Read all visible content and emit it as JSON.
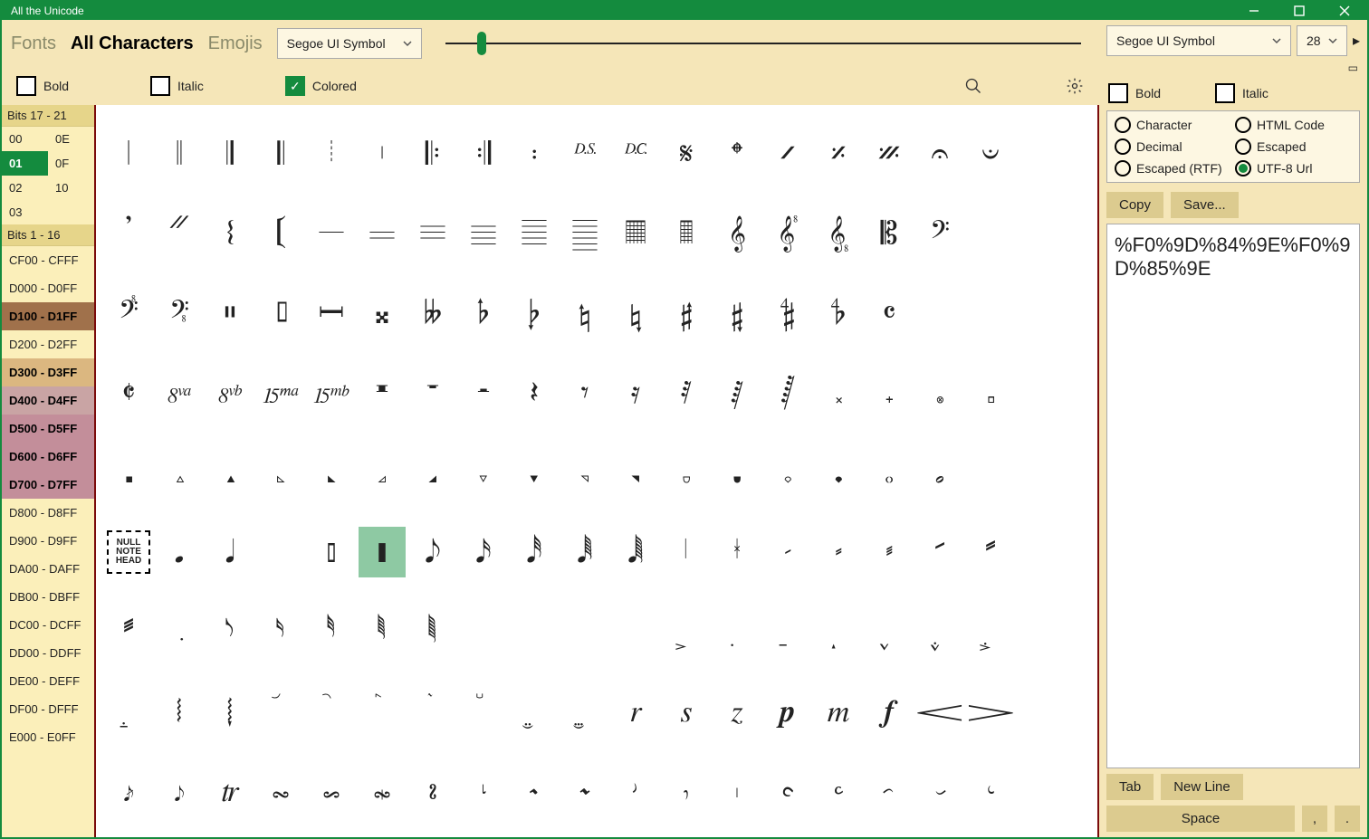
{
  "app_title": "All the Unicode",
  "tabs": {
    "fonts": "Fonts",
    "all": "All Characters",
    "emojis": "Emojis"
  },
  "font_select": "Segoe UI Symbol",
  "checks": {
    "bold": "Bold",
    "italic": "Italic",
    "colored": "Colored"
  },
  "sidebar": {
    "hdr_bits_hi": "Bits 17 - 21",
    "bits_hi": [
      [
        "00",
        "0E"
      ],
      [
        "01",
        "0F"
      ],
      [
        "02",
        "10"
      ],
      [
        "03",
        ""
      ]
    ],
    "hdr_bits_lo": "Bits 1 - 16",
    "ranges": [
      {
        "label": "CF00 - CFFF",
        "cls": "a"
      },
      {
        "label": "D000 - D0FF",
        "cls": "a"
      },
      {
        "label": "D100 - D1FF",
        "cls": "b"
      },
      {
        "label": "D200 - D2FF",
        "cls": "a"
      },
      {
        "label": "D300 - D3FF",
        "cls": "c"
      },
      {
        "label": "D400 - D4FF",
        "cls": "d"
      },
      {
        "label": "D500 - D5FF",
        "cls": "e"
      },
      {
        "label": "D600 - D6FF",
        "cls": "e"
      },
      {
        "label": "D700 - D7FF",
        "cls": "e"
      },
      {
        "label": "D800 - D8FF",
        "cls": "a"
      },
      {
        "label": "D900 - D9FF",
        "cls": "a"
      },
      {
        "label": "DA00 - DAFF",
        "cls": "a"
      },
      {
        "label": "DB00 - DBFF",
        "cls": "a"
      },
      {
        "label": "DC00 - DCFF",
        "cls": "a"
      },
      {
        "label": "DD00 - DDFF",
        "cls": "a"
      },
      {
        "label": "DE00 - DEFF",
        "cls": "a"
      },
      {
        "label": "DF00 - DFFF",
        "cls": "a"
      },
      {
        "label": "E000 - E0FF",
        "cls": "a"
      }
    ]
  },
  "right": {
    "font": "Segoe UI Symbol",
    "size": "28",
    "bold": "Bold",
    "italic": "Italic",
    "radios": {
      "char": "Character",
      "html": "HTML Code",
      "dec": "Decimal",
      "esc": "Escaped",
      "escrtf": "Escaped (RTF)",
      "utf8": "UTF-8 Url"
    },
    "copy": "Copy",
    "save": "Save...",
    "output": "%F0%9D%84%9E%F0%9D%85%9E",
    "tab": "Tab",
    "newline": "New Line",
    "space": "Space",
    "comma": ",",
    "dot": "."
  },
  "selected_index": 95,
  "chars": [
    "𝄀",
    "𝄁",
    "𝄂",
    "𝄃",
    "𝄄",
    "𝄅",
    "𝄆",
    "𝄇",
    "𝄈",
    "𝄉",
    "𝄊",
    "𝄋",
    "𝄌",
    "𝄍",
    "𝄎",
    "𝄏",
    "𝄐",
    "𝄑",
    "𝄒",
    "𝄓",
    "𝄔",
    "𝄕",
    "𝄖",
    "𝄗",
    "𝄘",
    "𝄙",
    "𝄚",
    "𝄛",
    "𝄜",
    "𝄝",
    "𝄞",
    "𝄟",
    "𝄠",
    "𝄡",
    "𝄢",
    "",
    "𝄣",
    "𝄤",
    "𝄥",
    "𝄦",
    "𝄩",
    "𝄪",
    "𝄫",
    "𝄬",
    "𝄭",
    "𝄮",
    "𝄯",
    "𝄰",
    "𝄱",
    "𝄲",
    "𝄳",
    "𝄴",
    "",
    "",
    "𝄵",
    "𝄶",
    "𝄷",
    "𝄸",
    "𝄹",
    "𝄺",
    "𝄻",
    "𝄼",
    "𝄽",
    "𝄾",
    "𝄿",
    "𝅀",
    "𝅁",
    "𝅂",
    "𝅃",
    "𝅄",
    "𝅅",
    "𝅆",
    "𝅇",
    "𝅈",
    "𝅉",
    "𝅊",
    "𝅋",
    "𝅌",
    "𝅍",
    "𝅎",
    "𝅏",
    "𝅐",
    "𝅑",
    "𝅒",
    "𝅓",
    "𝅔",
    "𝅕",
    "𝅖",
    "𝅗",
    "",
    "NULL",
    "𝅘",
    "𝅘𝅥",
    "𝅙",
    "𝅚",
    "𝅛",
    "𝅘𝅥𝅮",
    "𝅘𝅥𝅯",
    "𝅘𝅥𝅰",
    "𝅘𝅥𝅱",
    "𝅘𝅥𝅲",
    "𝅥",
    "𝅦",
    "𝅧",
    "𝅨",
    "𝅩",
    "𝅪",
    "𝅫",
    "𝅬",
    "𝅭",
    "𝅮",
    "𝅯",
    "𝅰",
    "𝅱",
    "𝅲",
    "",
    "",
    "",
    "",
    "𝅻",
    "𝅼",
    "𝅽",
    "𝅾",
    "𝅿",
    "𝆀",
    "𝆁",
    "𝆂",
    "𝆃",
    "𝆄",
    "𝆅",
    "𝆆",
    "𝆇",
    "𝆈",
    "𝆉",
    "𝆊",
    "𝆋",
    "𝆌",
    "𝆍",
    "𝆎",
    "𝆏",
    "𝆐",
    "𝆑",
    "𝆒",
    "𝆓",
    "𝆔",
    "𝆕",
    "𝆖",
    "𝆗",
    "𝆘",
    "𝆙",
    "𝆚",
    "𝆛",
    "𝆜",
    "𝆝",
    "𝆞",
    "𝆟",
    "𝆠",
    "𝆡",
    "𝆢",
    "𝆣",
    "𝆤",
    "𝆥"
  ]
}
